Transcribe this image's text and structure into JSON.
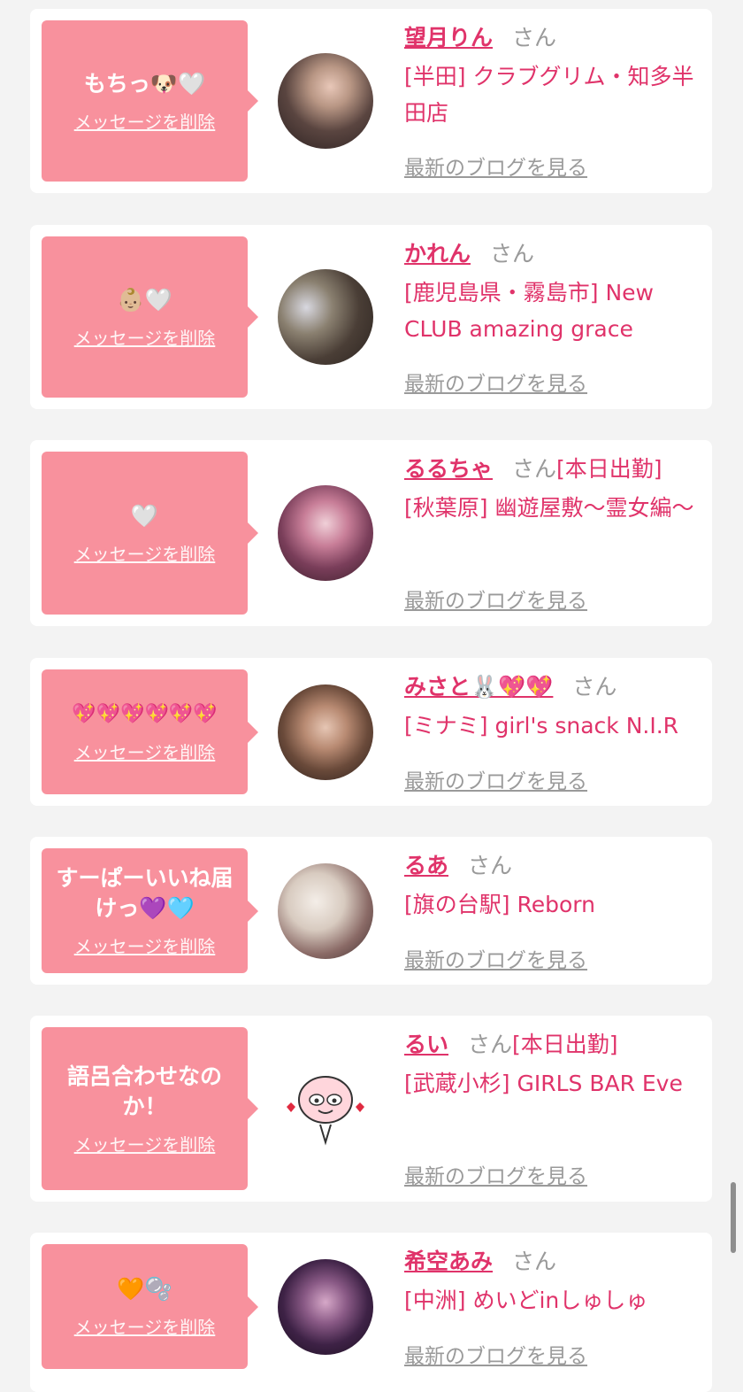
{
  "colors": {
    "bubble": "#f8919d",
    "accent": "#e0336a",
    "gray": "#9a9a9a"
  },
  "entries": [
    {
      "message": "もちっ🐶🤍",
      "delete_label": "メッセージを削除",
      "name": "望月りん",
      "honorific": "さん",
      "tag": "",
      "shop": "[半田] クラブグリム・知多半田店",
      "blog_label": "最新のブログを見る",
      "avatar_icon": "photo-avatar"
    },
    {
      "message": "👶🏼🤍",
      "delete_label": "メッセージを削除",
      "name": "かれん",
      "honorific": "さん",
      "tag": "",
      "shop": "[鹿児島県・霧島市] New CLUB amazing grace",
      "blog_label": "最新のブログを見る",
      "avatar_icon": "photo-avatar"
    },
    {
      "message": "🤍",
      "delete_label": "メッセージを削除",
      "name": "るるちゃ",
      "honorific": "さん",
      "tag": "[本日出勤]",
      "shop": "[秋葉原] 幽遊屋敷〜霊女編〜",
      "blog_label": "最新のブログを見る",
      "avatar_icon": "photo-avatar"
    },
    {
      "message": "💖💖💖💖💖💖",
      "delete_label": "メッセージを削除",
      "name": "みさと🐰💖💖",
      "honorific": "さん",
      "tag": "",
      "shop": "[ミナミ] girl's snack N.I.R",
      "blog_label": "最新のブログを見る",
      "avatar_icon": "photo-avatar"
    },
    {
      "message": "すーぱーいいね届けっ💜🩵",
      "delete_label": "メッセージを削除",
      "name": "るあ",
      "honorific": "さん",
      "tag": "",
      "shop": "[旗の台駅] Reborn",
      "blog_label": "最新のブログを見る",
      "avatar_icon": "photo-avatar"
    },
    {
      "message": "語呂合わせなのか！",
      "delete_label": "メッセージを削除",
      "name": "るい",
      "honorific": "さん",
      "tag": "[本日出勤]",
      "shop": "[武蔵小杉] GIRLS BAR Eve",
      "blog_label": "最新のブログを見る",
      "avatar_icon": "peach-character-icon"
    },
    {
      "message": "🧡🫧",
      "delete_label": "メッセージを削除",
      "name": "希空あみ",
      "honorific": "さん",
      "tag": "",
      "shop": "[中洲] めいどinしゅしゅ",
      "blog_label": "最新のブログを見る",
      "avatar_icon": "photo-avatar"
    }
  ]
}
